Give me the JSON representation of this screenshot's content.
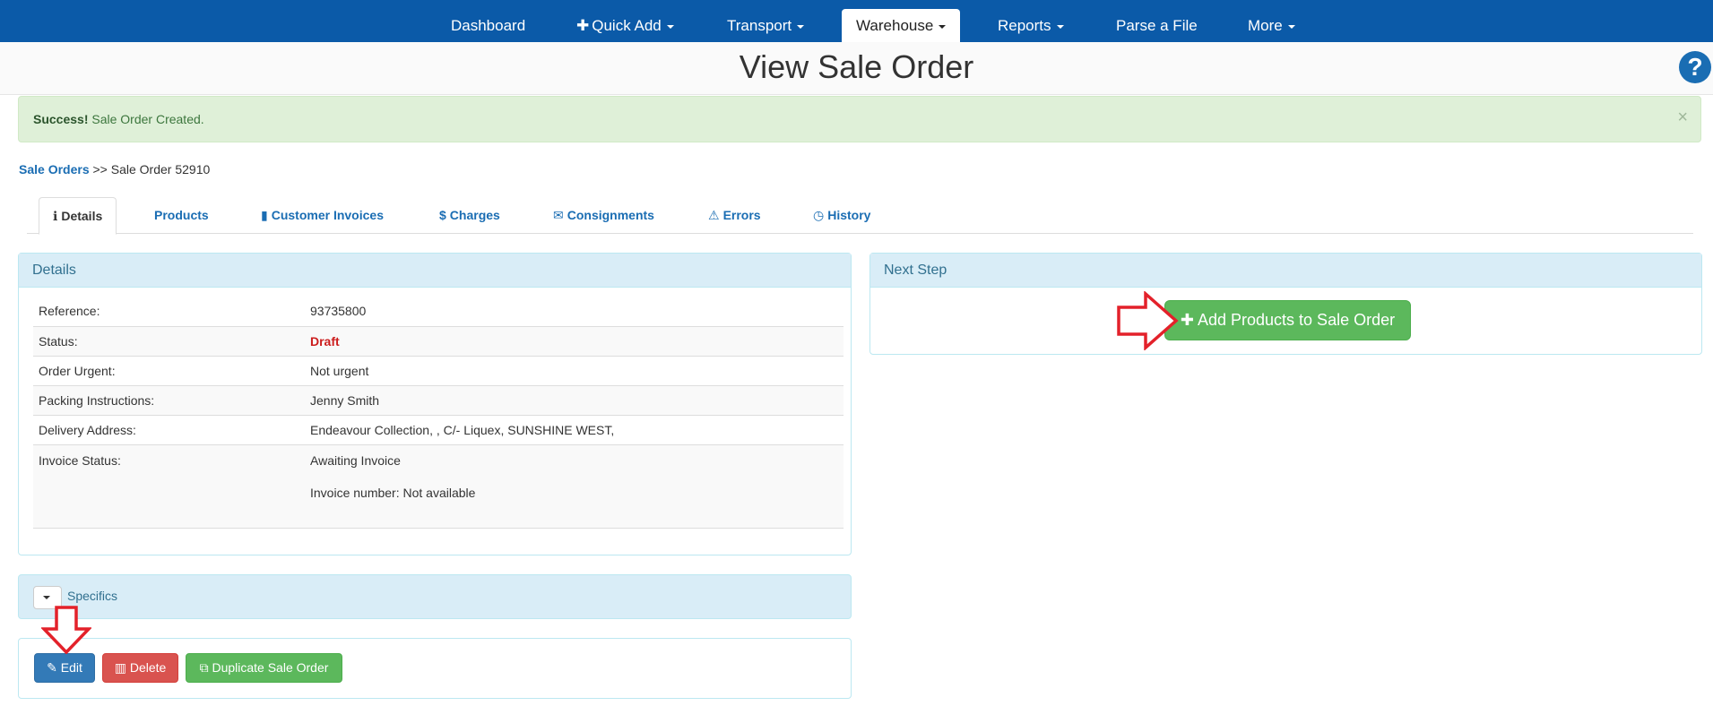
{
  "nav": {
    "items": [
      {
        "label": "Dashboard",
        "has_caret": false,
        "has_plus": false
      },
      {
        "label": "Quick Add",
        "has_caret": true,
        "has_plus": true
      },
      {
        "label": "Transport",
        "has_caret": true,
        "has_plus": false
      },
      {
        "label": "Warehouse",
        "has_caret": true,
        "has_plus": false,
        "active": true
      },
      {
        "label": "Reports",
        "has_caret": true,
        "has_plus": false
      },
      {
        "label": "Parse a File",
        "has_caret": false,
        "has_plus": false
      },
      {
        "label": "More",
        "has_caret": true,
        "has_plus": false
      }
    ],
    "colors": {
      "bar": "#0b5aa8",
      "active_bg": "#ffffff"
    }
  },
  "page": {
    "title": "View Sale Order",
    "help_icon": "question-circle-icon"
  },
  "alert": {
    "strong": "Success!",
    "message": "Sale Order Created.",
    "close": "×",
    "color": "#dff0d8"
  },
  "breadcrumb": {
    "link": "Sale Orders",
    "separator": ">>",
    "current": "Sale Order 52910"
  },
  "tabs": [
    {
      "label": "Details",
      "icon": "info-icon",
      "glyph": "ℹ",
      "active": true
    },
    {
      "label": "Products",
      "icon": "",
      "glyph": ""
    },
    {
      "label": "Customer Invoices",
      "icon": "file-icon",
      "glyph": "▮"
    },
    {
      "label": "Charges",
      "icon": "dollar-icon",
      "glyph": "$"
    },
    {
      "label": "Consignments",
      "icon": "envelope-icon",
      "glyph": "✉"
    },
    {
      "label": "Errors",
      "icon": "warning-icon",
      "glyph": "⚠"
    },
    {
      "label": "History",
      "icon": "clock-icon",
      "glyph": "◷"
    }
  ],
  "details": {
    "heading": "Details",
    "rows": [
      {
        "label": "Reference:",
        "value": "93735800"
      },
      {
        "label": "Status:",
        "value": "Draft"
      },
      {
        "label": "Order Urgent:",
        "value": "Not urgent"
      },
      {
        "label": "Packing Instructions:",
        "value": "Jenny Smith"
      },
      {
        "label": "Delivery Address:",
        "value": "Endeavour Collection, , C/- Liquex, SUNSHINE WEST,"
      }
    ],
    "invoice": {
      "label": "Invoice Status:",
      "value": "Awaiting Invoice",
      "number": "Invoice number: Not available"
    }
  },
  "specifics": {
    "label": "Specifics"
  },
  "actions": {
    "edit": "Edit",
    "delete": "Delete",
    "duplicate": "Duplicate Sale Order"
  },
  "next_step": {
    "heading": "Next Step",
    "button": "Add Products to Sale Order"
  },
  "colors": {
    "status_draft": "#cc1e1e",
    "primary": "#337ab7",
    "danger": "#d9534f",
    "success": "#5cb85c",
    "annotation_arrow": "#e3212a"
  }
}
